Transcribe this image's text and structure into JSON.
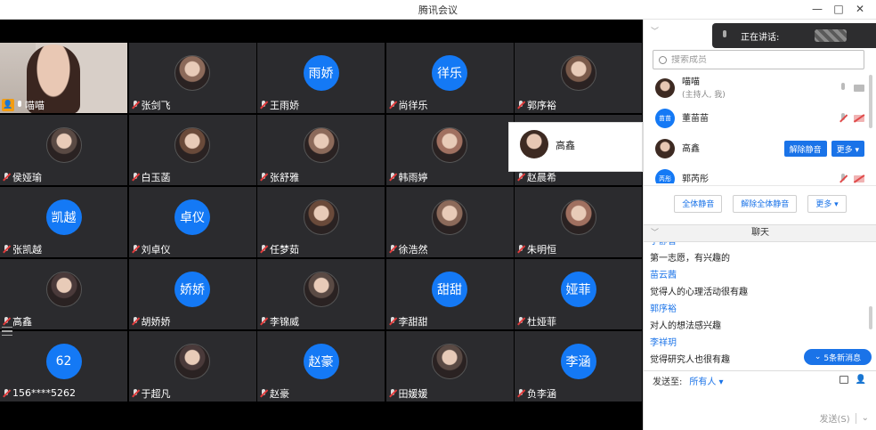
{
  "window": {
    "title": "腾讯会议"
  },
  "window_buttons": {
    "minimize": "—",
    "maximize": "□",
    "close": "✕"
  },
  "tiles": [
    {
      "name": "喵喵",
      "kind": "selfcam",
      "mic": "on"
    },
    {
      "name": "张剑飞",
      "kind": "photo",
      "mic": "off"
    },
    {
      "name": "王雨娇",
      "kind": "blue",
      "avatar_text": "雨娇",
      "mic": "off"
    },
    {
      "name": "尚徉乐",
      "kind": "blue",
      "avatar_text": "徉乐",
      "mic": "off"
    },
    {
      "name": "郭序裕",
      "kind": "photo",
      "mic": "off"
    },
    {
      "name": "侯娅瑜",
      "kind": "photo",
      "mic": "off"
    },
    {
      "name": "白玉菡",
      "kind": "photo",
      "mic": "off"
    },
    {
      "name": "张舒雅",
      "kind": "photo",
      "mic": "off"
    },
    {
      "name": "韩雨婷",
      "kind": "photo",
      "mic": "off"
    },
    {
      "name": "赵晨希",
      "kind": "photo",
      "mic": "off"
    },
    {
      "name": "张凯越",
      "kind": "blue",
      "avatar_text": "凯越",
      "mic": "off"
    },
    {
      "name": "刘卓仪",
      "kind": "blue",
      "avatar_text": "卓仪",
      "mic": "off"
    },
    {
      "name": "任梦茹",
      "kind": "photo",
      "mic": "off"
    },
    {
      "name": "徐浩然",
      "kind": "photo",
      "mic": "off"
    },
    {
      "name": "朱明恒",
      "kind": "photo",
      "mic": "off"
    },
    {
      "name": "高鑫",
      "kind": "photo",
      "mic": "off"
    },
    {
      "name": "胡娇娇",
      "kind": "blue",
      "avatar_text": "娇娇",
      "mic": "off"
    },
    {
      "name": "李锦威",
      "kind": "photo",
      "mic": "off"
    },
    {
      "name": "李甜甜",
      "kind": "blue",
      "avatar_text": "甜甜",
      "mic": "off"
    },
    {
      "name": "杜娅菲",
      "kind": "blue",
      "avatar_text": "娅菲",
      "mic": "off"
    },
    {
      "name": "156****5262",
      "kind": "blue",
      "avatar_text": "62",
      "mic": "off"
    },
    {
      "name": "于超凡",
      "kind": "photo",
      "mic": "off"
    },
    {
      "name": "赵豪",
      "kind": "blue",
      "avatar_text": "赵豪",
      "mic": "off"
    },
    {
      "name": "田媛媛",
      "kind": "photo",
      "mic": "off"
    },
    {
      "name": "负李涵",
      "kind": "blue",
      "avatar_text": "李涵",
      "mic": "off"
    }
  ],
  "popup": {
    "name": "高鑫"
  },
  "speaking": {
    "label": "正在讲话:"
  },
  "members": {
    "search_placeholder": "搜索成员",
    "list": [
      {
        "name": "喵喵",
        "sub": "(主持人, 我)",
        "avatar": "photo"
      },
      {
        "name": "董苗苗",
        "avatar": "blue",
        "avatar_text": "苗苗"
      },
      {
        "name": "高鑫",
        "avatar": "photo",
        "unmute": "解除静音",
        "more": "更多 ▾"
      },
      {
        "name": "郭芮彤",
        "avatar": "blue",
        "avatar_text": "芮彤"
      }
    ]
  },
  "panel_buttons": {
    "mute_all": "全体静音",
    "unmute_all": "解除全体静音",
    "more": "更多 ▾"
  },
  "chat": {
    "title": "聊天",
    "messages": [
      {
        "name": "宁静音",
        "text": "第一志愿，有兴趣的"
      },
      {
        "name": "苗云茜",
        "text": "觉得人的心理活动很有趣"
      },
      {
        "name": "郭序裕",
        "text": "对人的想法感兴趣"
      },
      {
        "name": "李祥玥",
        "text": "觉得研究人也很有趣"
      }
    ],
    "new_messages": "5条新消息",
    "send_to_label": "发送至:",
    "send_target": "所有人 ▾",
    "send_button": "发送(S)"
  },
  "colors": {
    "accent": "#1479f5",
    "tile_bg": "#2b2b2e",
    "mic_off": "#e23c3c"
  }
}
